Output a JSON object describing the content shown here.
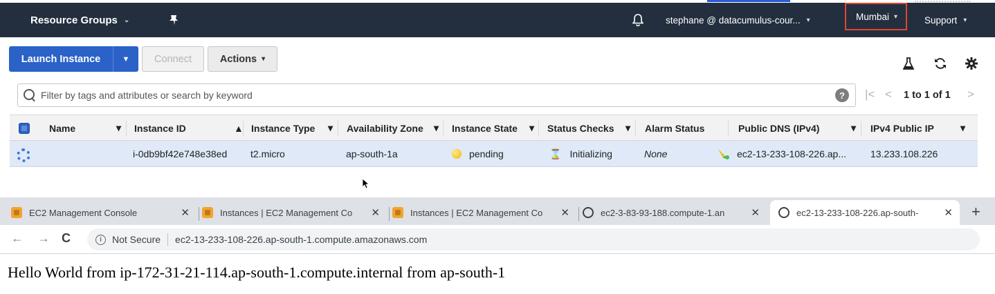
{
  "aws_nav": {
    "resource_groups_label": "Resource Groups",
    "account_label": "stephane @ datacumulus-cour...",
    "region_label": "Mumbai",
    "support_label": "Support"
  },
  "toolbar": {
    "launch_label": "Launch Instance",
    "connect_label": "Connect",
    "actions_label": "Actions"
  },
  "filter": {
    "placeholder": "Filter by tags and attributes or search by keyword",
    "pagination": "1 to 1 of 1"
  },
  "table": {
    "columns": [
      "Name",
      "Instance ID",
      "Instance Type",
      "Availability Zone",
      "Instance State",
      "Status Checks",
      "Alarm Status",
      "Public DNS (IPv4)",
      "IPv4 Public IP"
    ],
    "row": {
      "name": "",
      "instance_id": "i-0db9bf42e748e38ed",
      "instance_type": "t2.micro",
      "availability_zone": "ap-south-1a",
      "instance_state": "pending",
      "status_checks": "Initializing",
      "alarm_status": "None",
      "public_dns": "ec2-13-233-108-226.ap...",
      "public_ip": "13.233.108.226"
    }
  },
  "browser": {
    "tabs": [
      {
        "title": "EC2 Management Console"
      },
      {
        "title": "Instances | EC2 Management Co"
      },
      {
        "title": "Instances | EC2 Management Co"
      },
      {
        "title": "ec2-3-83-93-188.compute-1.an"
      },
      {
        "title": "ec2-13-233-108-226.ap-south-"
      }
    ],
    "not_secure": "Not Secure",
    "url": "ec2-13-233-108-226.ap-south-1.compute.amazonaws.com"
  },
  "page": {
    "body_text": "Hello World from ip-172-31-21-114.ap-south-1.compute.internal from ap-south-1"
  },
  "colors": {
    "nav_bg": "#232f3e",
    "primary_button": "#2b62c8",
    "selected_row": "#dfe9f7",
    "region_highlight": "#e0462c"
  }
}
